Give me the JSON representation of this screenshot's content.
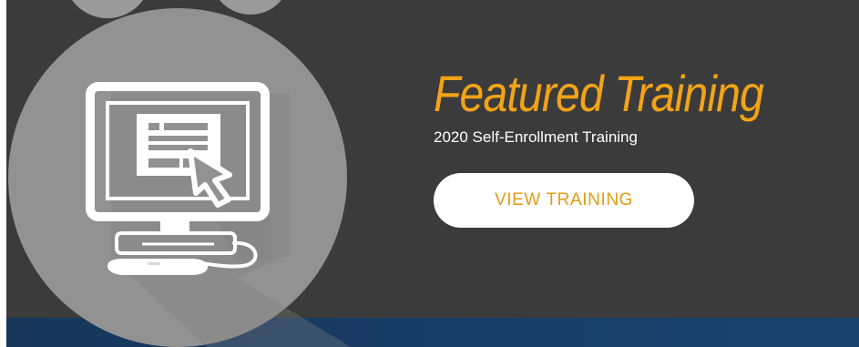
{
  "hero": {
    "title": "Featured Training",
    "subtitle": "2020 Self-Enrollment Training",
    "button_label": "VIEW TRAINING"
  },
  "icons": {
    "illustration": "computer-training-icon",
    "cursor": "mouse-cursor-icon"
  },
  "colors": {
    "banner_background": "#3b3b3b",
    "accent": "#f2a416",
    "button_text": "#e39b14",
    "circle": "#929292",
    "bottom_band": "#183c67"
  }
}
